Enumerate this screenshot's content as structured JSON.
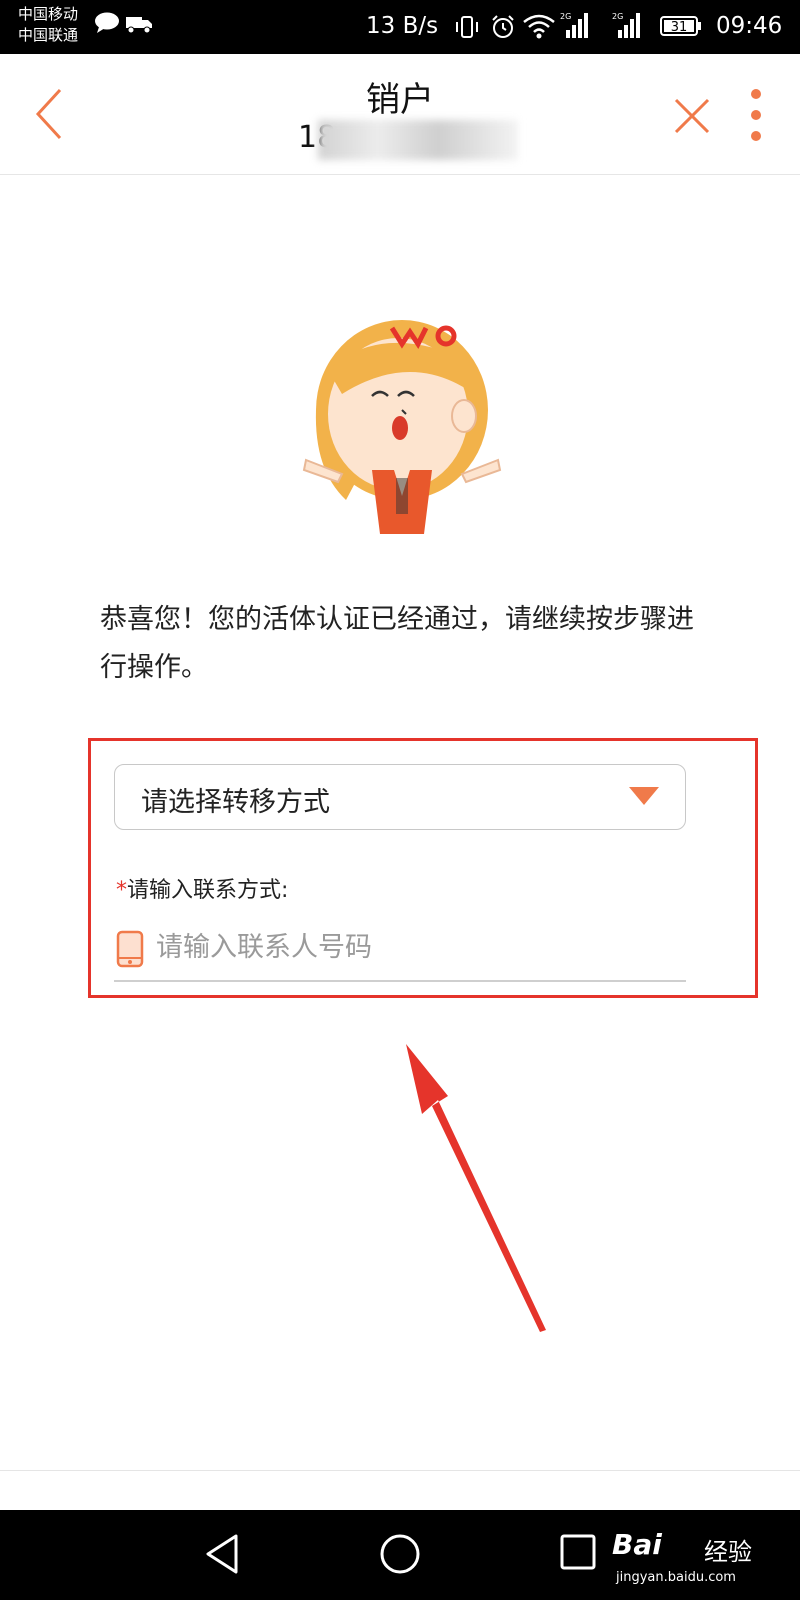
{
  "status_bar": {
    "carrier_1": "中国移动",
    "carrier_2": "中国联通",
    "network_speed": "13 B/s",
    "battery": "31",
    "time": "09:46",
    "signal_tag": "2G"
  },
  "header": {
    "title": "销户",
    "subtitle": "18",
    "back_icon": "chevron-left-icon",
    "close_icon": "close-icon",
    "more_icon": "more-vertical-icon"
  },
  "mascot": {
    "brand_mark": "WO"
  },
  "main": {
    "message": "恭喜您！您的活体认证已经通过，请继续按步骤进行操作。",
    "transfer_select": {
      "value": "请选择转移方式"
    },
    "contact_field": {
      "required_mark": "*",
      "label": "请输入联系方式:",
      "placeholder": "请输入联系人号码",
      "value": ""
    }
  },
  "watermark": {
    "logo": "Bai",
    "brand": "经验",
    "url": "jingyan.baidu.com"
  },
  "colors": {
    "accent": "#f07a4a",
    "highlight": "#e5342b",
    "status_bar_bg": "#000000"
  }
}
